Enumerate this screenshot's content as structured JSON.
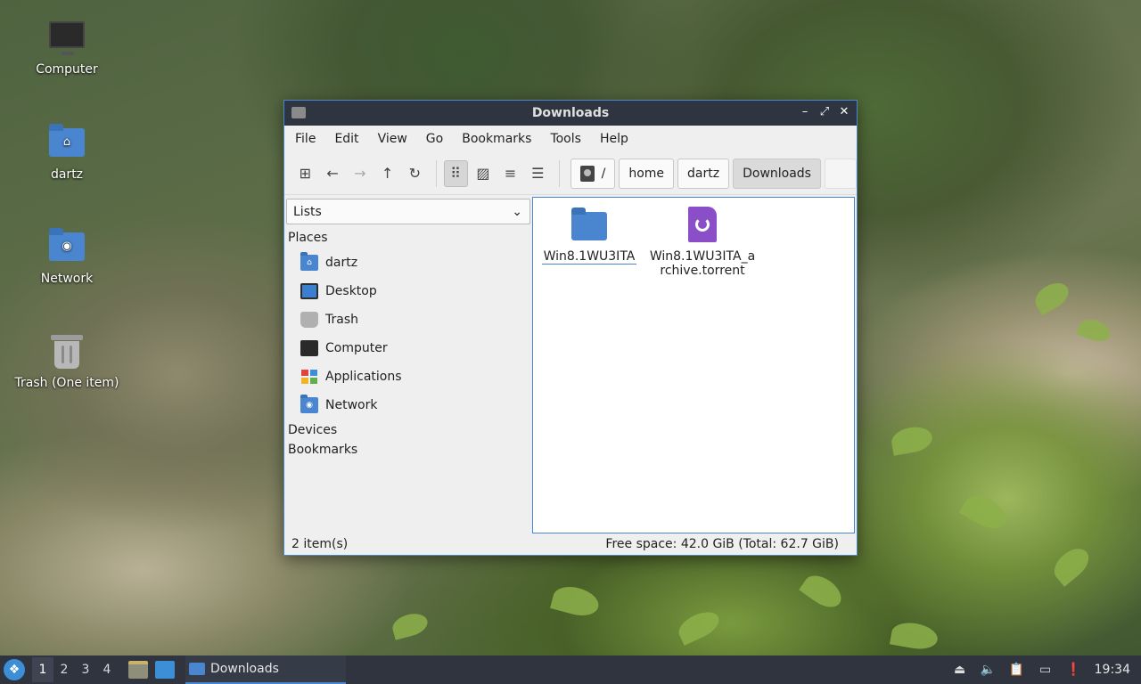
{
  "desktop": {
    "icons": [
      {
        "label": "Computer"
      },
      {
        "label": "dartz"
      },
      {
        "label": "Network"
      },
      {
        "label": "Trash (One item)"
      }
    ]
  },
  "window": {
    "title": "Downloads",
    "menu": [
      "File",
      "Edit",
      "View",
      "Go",
      "Bookmarks",
      "Tools",
      "Help"
    ],
    "path": {
      "root": "/",
      "crumbs": [
        "home",
        "dartz",
        "Downloads"
      ]
    },
    "sidepane": {
      "mode": "Lists",
      "places_header": "Places",
      "places": [
        "dartz",
        "Desktop",
        "Trash",
        "Computer",
        "Applications",
        "Network"
      ],
      "devices_header": "Devices",
      "bookmarks_header": "Bookmarks"
    },
    "files": [
      {
        "line1": "Win8.1WU3ITA",
        "line2": ""
      },
      {
        "line1": "Win8.1WU3ITA_a",
        "line2": "rchive.torrent"
      }
    ],
    "status": {
      "items": "2 item(s)",
      "free_space": "Free space: 42.0 GiB (Total: 62.7 GiB)"
    }
  },
  "taskbar": {
    "workspaces": [
      "1",
      "2",
      "3",
      "4"
    ],
    "task_label": "Downloads",
    "clock": "19:34"
  },
  "colors": {
    "accent": "#4a86cf",
    "taskbar": "#2f343f",
    "titlebar": "#2e3440",
    "torrent": "#8a4fc8"
  }
}
